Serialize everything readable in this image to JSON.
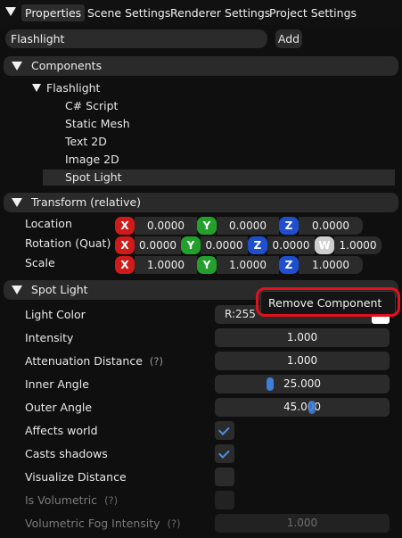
{
  "tabs": [
    "Properties",
    "Scene Settings",
    "Renderer Settings",
    "Project Settings"
  ],
  "entity": {
    "name": "Flashlight",
    "add_label": "Add"
  },
  "components": {
    "header": "Components",
    "root": "Flashlight",
    "items": [
      "C# Script",
      "Static Mesh",
      "Text 2D",
      "Image 2D",
      "Spot Light"
    ],
    "selected": "Spot Light"
  },
  "transform": {
    "header": "Transform (relative)",
    "location_label": "Location",
    "rotation_label": "Rotation (Quat)",
    "scale_label": "Scale",
    "axes": {
      "x": "X",
      "y": "Y",
      "z": "Z",
      "w": "W"
    },
    "location": {
      "x": "0.0000",
      "y": "0.0000",
      "z": "0.0000"
    },
    "rotation": {
      "x": "0.0000",
      "y": "0.0000",
      "z": "0.0000",
      "w": "1.0000"
    },
    "scale": {
      "x": "1.0000",
      "y": "1.0000",
      "z": "1.0000"
    },
    "colors": {
      "x": "#d11a1a",
      "y": "#23a02c",
      "z": "#1f4fcf",
      "w": "#cfcfcf"
    }
  },
  "spot_light": {
    "header": "Spot Light",
    "light_color_label": "Light Color",
    "light_color_r": "R:255",
    "intensity_label": "Intensity",
    "intensity": "1.000",
    "attenuation_label": "Attenuation Distance",
    "attenuation": "1.000",
    "inner_angle_label": "Inner Angle",
    "inner_angle": "25.000",
    "outer_angle_label": "Outer Angle",
    "outer_angle": "45.000",
    "affects_world_label": "Affects world",
    "affects_world": true,
    "casts_shadows_label": "Casts shadows",
    "casts_shadows": true,
    "visualize_distance_label": "Visualize Distance",
    "visualize_distance": false,
    "is_volumetric_label": "Is Volumetric",
    "is_volumetric": false,
    "volumetric_fog_label": "Volumetric Fog Intensity",
    "volumetric_fog": "1.000",
    "help_mark": "(?)"
  },
  "context_menu": {
    "remove_component": "Remove Component"
  }
}
